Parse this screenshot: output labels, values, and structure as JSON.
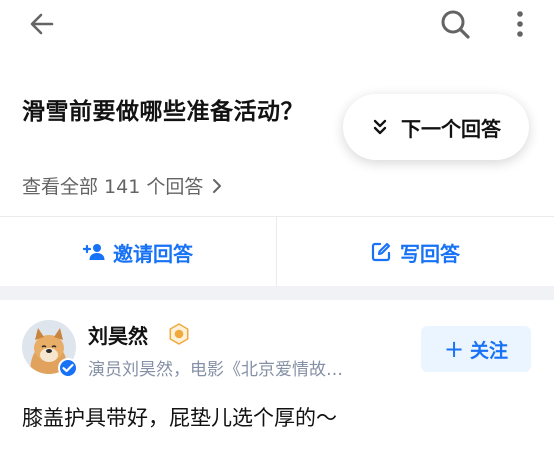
{
  "question": {
    "title": "滑雪前要做哪些准备活动？",
    "view_all": "查看全部 141 个回答"
  },
  "next_answer": {
    "label": "下一个回答"
  },
  "actions": {
    "invite_label": "邀请回答",
    "write_label": "写回答"
  },
  "answer": {
    "author_name": "刘昊然",
    "author_bio": "演员刘昊然，电影《北京爱情故…",
    "follow_label": "关注",
    "follow_plus": "+",
    "excerpt": "膝盖护具带好，屁垫儿选个厚的～"
  },
  "colors": {
    "accent": "#1772f6",
    "follow_bg": "#ebf5ff",
    "separator": "#f0f2f5",
    "badge": "#f0a93b"
  },
  "icons": {
    "back": "back-arrow-icon",
    "search": "search-icon",
    "more": "more-vertical-icon",
    "next": "double-chevron-down-icon",
    "invite": "add-person-icon",
    "write": "edit-icon",
    "badge": "creator-level-badge-icon",
    "verified": "verified-check-icon"
  }
}
